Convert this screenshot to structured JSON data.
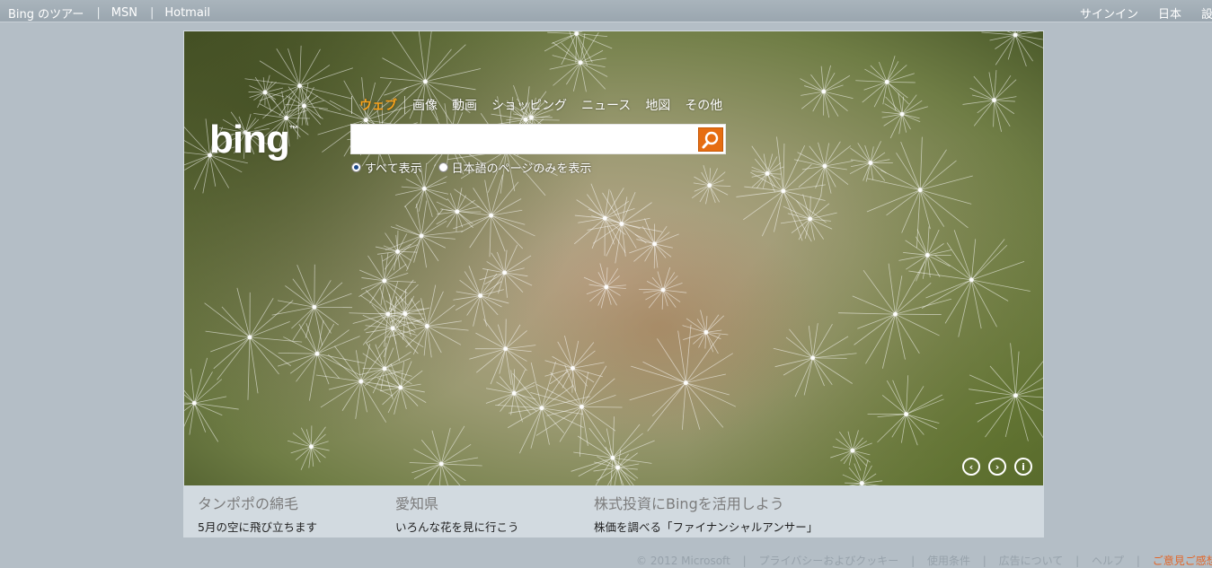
{
  "topbar": {
    "left_links": [
      "Bing のツアー",
      "MSN",
      "Hotmail"
    ],
    "separator": "|",
    "right_links": [
      "サインイン",
      "日本",
      "設定"
    ]
  },
  "logo": {
    "text": "bing",
    "mark": "™"
  },
  "nav": {
    "items": [
      "ウェブ",
      "画像",
      "動画",
      "ショッピング",
      "ニュース",
      "地図",
      "その他"
    ],
    "active_index": 0,
    "active_color": "#f7a21b"
  },
  "search": {
    "value": "",
    "placeholder": "",
    "button_icon": "search-icon",
    "button_color": "#e66d12"
  },
  "scope": {
    "options": [
      "すべて表示",
      "日本語のページのみを表示"
    ],
    "selected_index": 0
  },
  "hero_controls": {
    "prev_icon": "chevron-left-icon",
    "next_icon": "chevron-right-icon",
    "info_icon": "info-icon",
    "prev_glyph": "‹",
    "next_glyph": "›",
    "info_glyph": "i"
  },
  "hotspots": [
    {
      "title": "タンポポの綿毛",
      "subtitle": "5月の空に飛び立ちます"
    },
    {
      "title": "愛知県",
      "subtitle": "いろんな花を見に行こう"
    },
    {
      "title": "株式投資にBingを活用しよう",
      "subtitle": "株価を調べる「ファイナンシャルアンサー」"
    }
  ],
  "footer": {
    "copyright": "© 2012 Microsoft",
    "links": [
      "プライバシーおよびクッキー",
      "使用条件",
      "広告について",
      "ヘルプ"
    ],
    "separator": "|",
    "feedback": "ご意見ご感想"
  }
}
